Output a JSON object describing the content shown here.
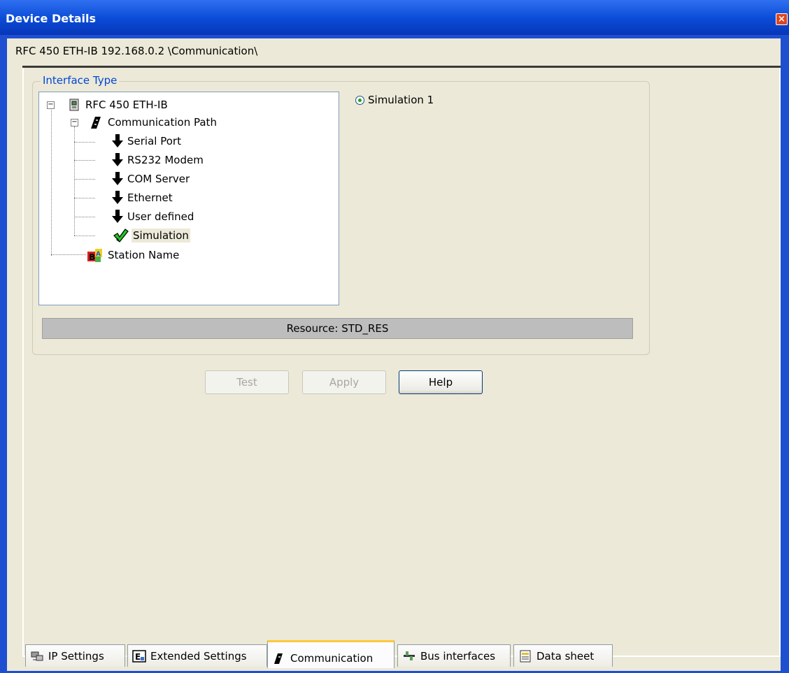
{
  "window": {
    "title": "Device Details",
    "close_glyph": "×"
  },
  "path": "RFC 450 ETH-IB 192.168.0.2 \\Communication\\",
  "interface_group": {
    "label": "Interface Type",
    "tree": {
      "root": {
        "label": "RFC 450 ETH-IB",
        "icon": "device-icon",
        "expander": "−"
      },
      "comm_path": {
        "label": "Communication Path",
        "icon": "communication-icon",
        "expander": "−"
      },
      "items": [
        {
          "label": "Serial Port",
          "icon": "down-arrow-icon"
        },
        {
          "label": "RS232 Modem",
          "icon": "down-arrow-icon"
        },
        {
          "label": "COM Server",
          "icon": "down-arrow-icon"
        },
        {
          "label": "Ethernet",
          "icon": "down-arrow-icon"
        },
        {
          "label": "User defined",
          "icon": "down-arrow-icon"
        },
        {
          "label": "Simulation",
          "icon": "checkmark-icon",
          "selected": true
        }
      ],
      "station": {
        "label": "Station Name",
        "icon": "station-name-icon"
      }
    },
    "radio": {
      "label": "Simulation 1",
      "checked": true
    },
    "resource": "Resource: STD_RES"
  },
  "buttons": {
    "test": "Test",
    "apply": "Apply",
    "help": "Help"
  },
  "tabs": [
    {
      "label": "IP Settings",
      "icon": "network-icon"
    },
    {
      "label": "Extended Settings",
      "icon": "extended-settings-icon"
    },
    {
      "label": "Communication",
      "icon": "communication-icon",
      "active": true
    },
    {
      "label": "Bus interfaces",
      "icon": "bus-icon"
    },
    {
      "label": "Data sheet",
      "icon": "datasheet-icon"
    }
  ]
}
